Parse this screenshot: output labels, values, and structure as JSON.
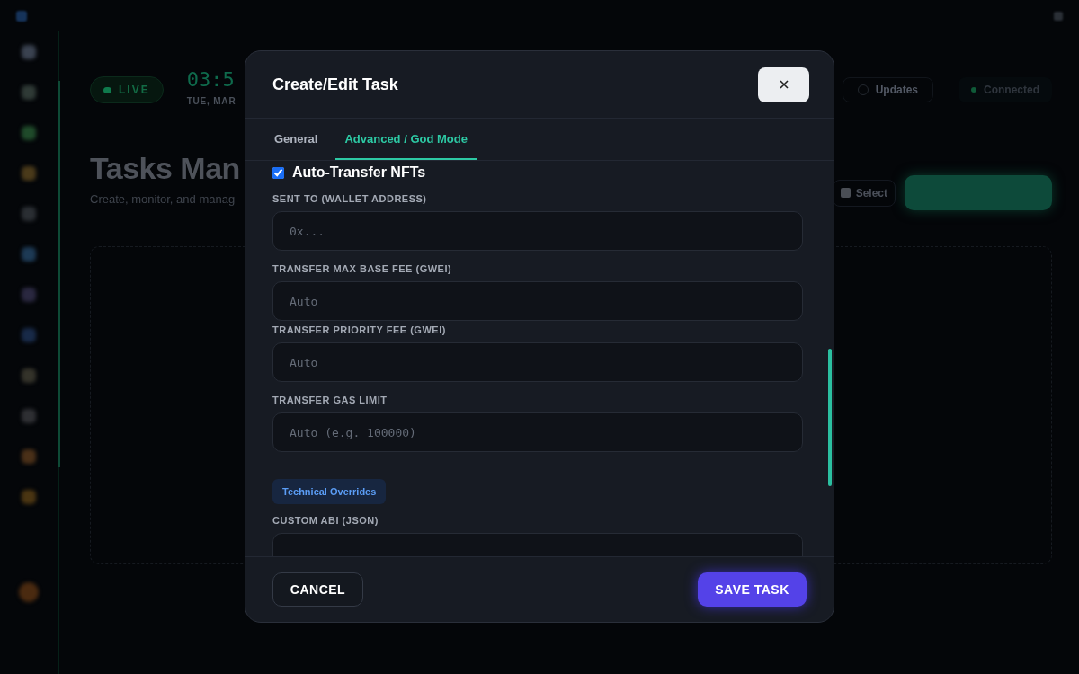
{
  "backdrop": {
    "live_badge": "LIVE",
    "clock": "03:5",
    "date": "TUE, MAR",
    "updates_button": "Updates",
    "connection_status": "Connected",
    "page_title": "Tasks Man",
    "page_subtitle": "Create, monitor, and manag",
    "select_button": "Select"
  },
  "dialog": {
    "title": "Create/Edit Task",
    "tabs": [
      {
        "label": "General",
        "selected": false
      },
      {
        "label": "Advanced / God Mode",
        "selected": true
      }
    ],
    "auto_transfer": {
      "label": "Auto-Transfer NFTs",
      "checked": true
    },
    "fields": [
      {
        "label": "SENT TO (WALLET ADDRESS)",
        "placeholder": "0x..."
      },
      {
        "label": "TRANSFER MAX BASE FEE (GWEI)",
        "placeholder": "Auto"
      },
      {
        "label": "TRANSFER PRIORITY FEE (GWEI)",
        "placeholder": "Auto"
      },
      {
        "label": "TRANSFER GAS LIMIT",
        "placeholder": "Auto (e.g. 100000)"
      }
    ],
    "section_badge": "Technical Overrides",
    "custom_abi_label": "CUSTOM ABI (JSON)",
    "cancel_button": "CANCEL",
    "save_button": "SAVE TASK"
  }
}
